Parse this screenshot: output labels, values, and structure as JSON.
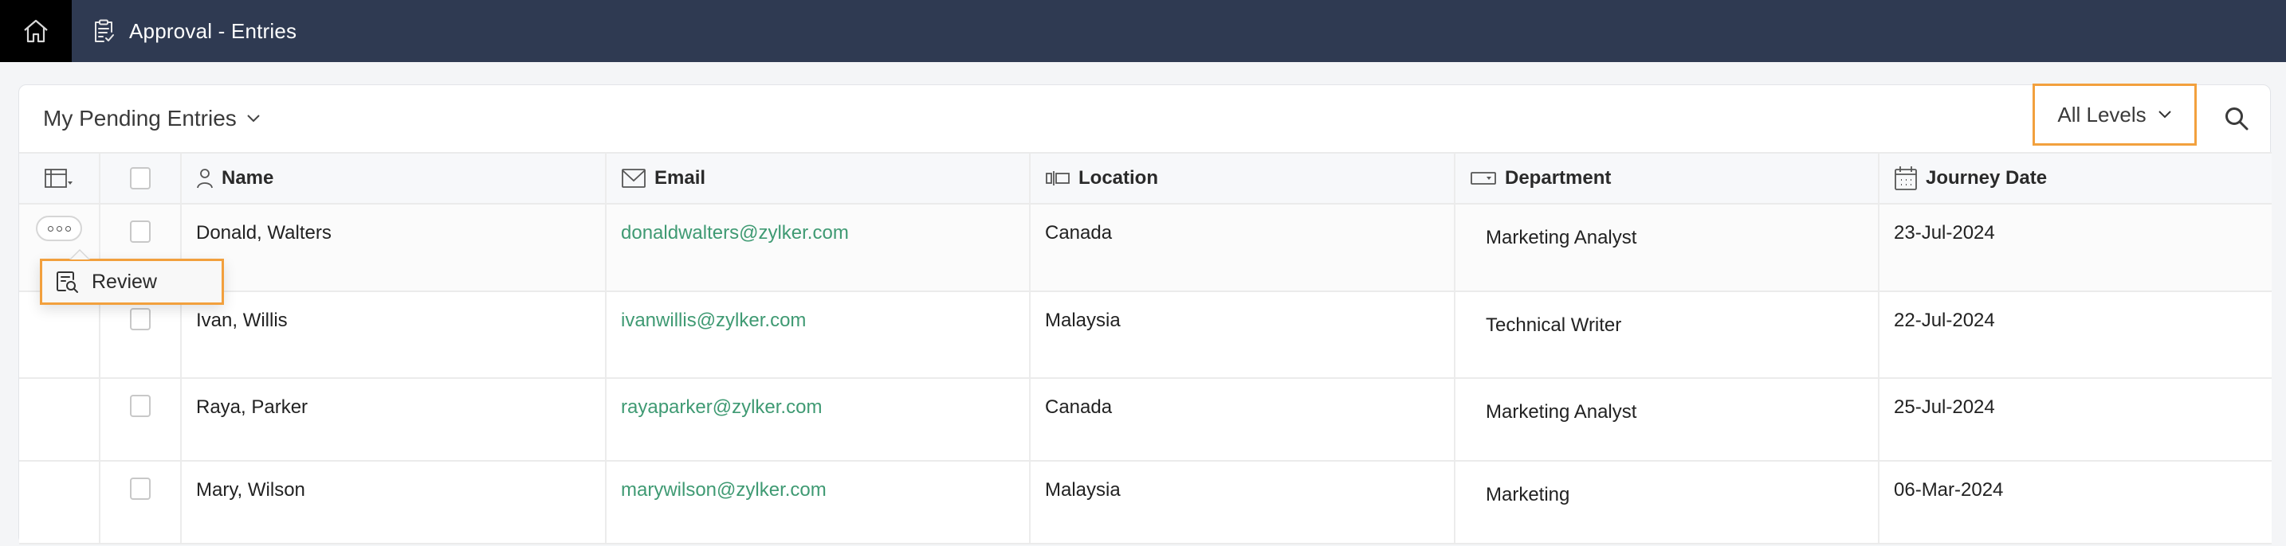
{
  "topbar": {
    "home_icon": "home-icon",
    "app_icon": "clipboard-check-icon",
    "title": "Approval - Entries"
  },
  "toolbar": {
    "view_label": "My Pending Entries",
    "view_icon": "chevron-down-icon",
    "levels_label": "All Levels",
    "levels_icon": "chevron-down-icon",
    "search_icon": "search-icon"
  },
  "table": {
    "columns": [
      {
        "key": "actions",
        "icon": "column-settings-icon",
        "label": ""
      },
      {
        "key": "select",
        "icon": "checkbox",
        "label": ""
      },
      {
        "key": "name",
        "icon": "person-icon",
        "label": "Name"
      },
      {
        "key": "email",
        "icon": "mail-icon",
        "label": "Email"
      },
      {
        "key": "location",
        "icon": "location-field-icon",
        "label": "Location"
      },
      {
        "key": "department",
        "icon": "dropdown-field-icon",
        "label": "Department"
      },
      {
        "key": "journey_date",
        "icon": "calendar-icon",
        "label": "Journey Date"
      }
    ],
    "rows": [
      {
        "name": "Donald, Walters",
        "email": "donaldwalters@zylker.com",
        "location": "Canada",
        "department": "Marketing Analyst",
        "journey_date": "23-Jul-2024"
      },
      {
        "name": "Ivan, Willis",
        "email": "ivanwillis@zylker.com",
        "location": "Malaysia",
        "department": "Technical Writer",
        "journey_date": "22-Jul-2024"
      },
      {
        "name": "Raya, Parker",
        "email": "rayaparker@zylker.com",
        "location": "Canada",
        "department": "Marketing Analyst",
        "journey_date": "25-Jul-2024"
      },
      {
        "name": "Mary, Wilson",
        "email": "marywilson@zylker.com",
        "location": "Malaysia",
        "department": "Marketing",
        "journey_date": "06-Mar-2024"
      }
    ]
  },
  "row_menu": {
    "items": [
      {
        "label": "Review",
        "icon": "review-icon"
      }
    ]
  },
  "colors": {
    "topbar_bg": "#2f3a52",
    "home_bg": "#000000",
    "highlight_border": "#f2a03d",
    "email_link": "#3f9a73",
    "page_bg": "#f4f5f7"
  }
}
